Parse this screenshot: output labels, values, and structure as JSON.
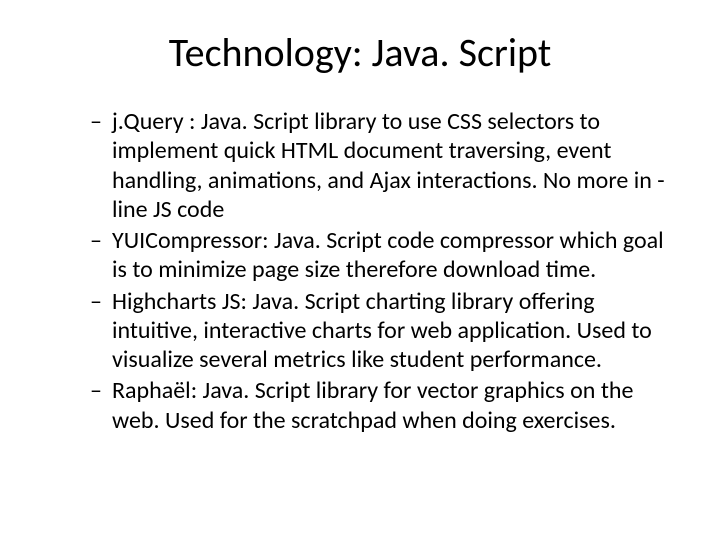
{
  "title": "Technology: Java. Script",
  "bullets": [
    "j.Query : Java. Script library to use CSS selectors  to implement quick HTML  document traversing, event handling, animations, and Ajax interactions. No more in -line JS code",
    "YUICompressor:  Java. Script code compressor which goal is to minimize page size therefore download time.",
    "Highcharts JS:  Java. Script charting library offering intuitive, interactive charts for web application.  Used to visualize several metrics like student performance.",
    "Raphaël:   Java. Script library for vector graphics on the web. Used for the scratchpad when doing exercises."
  ]
}
